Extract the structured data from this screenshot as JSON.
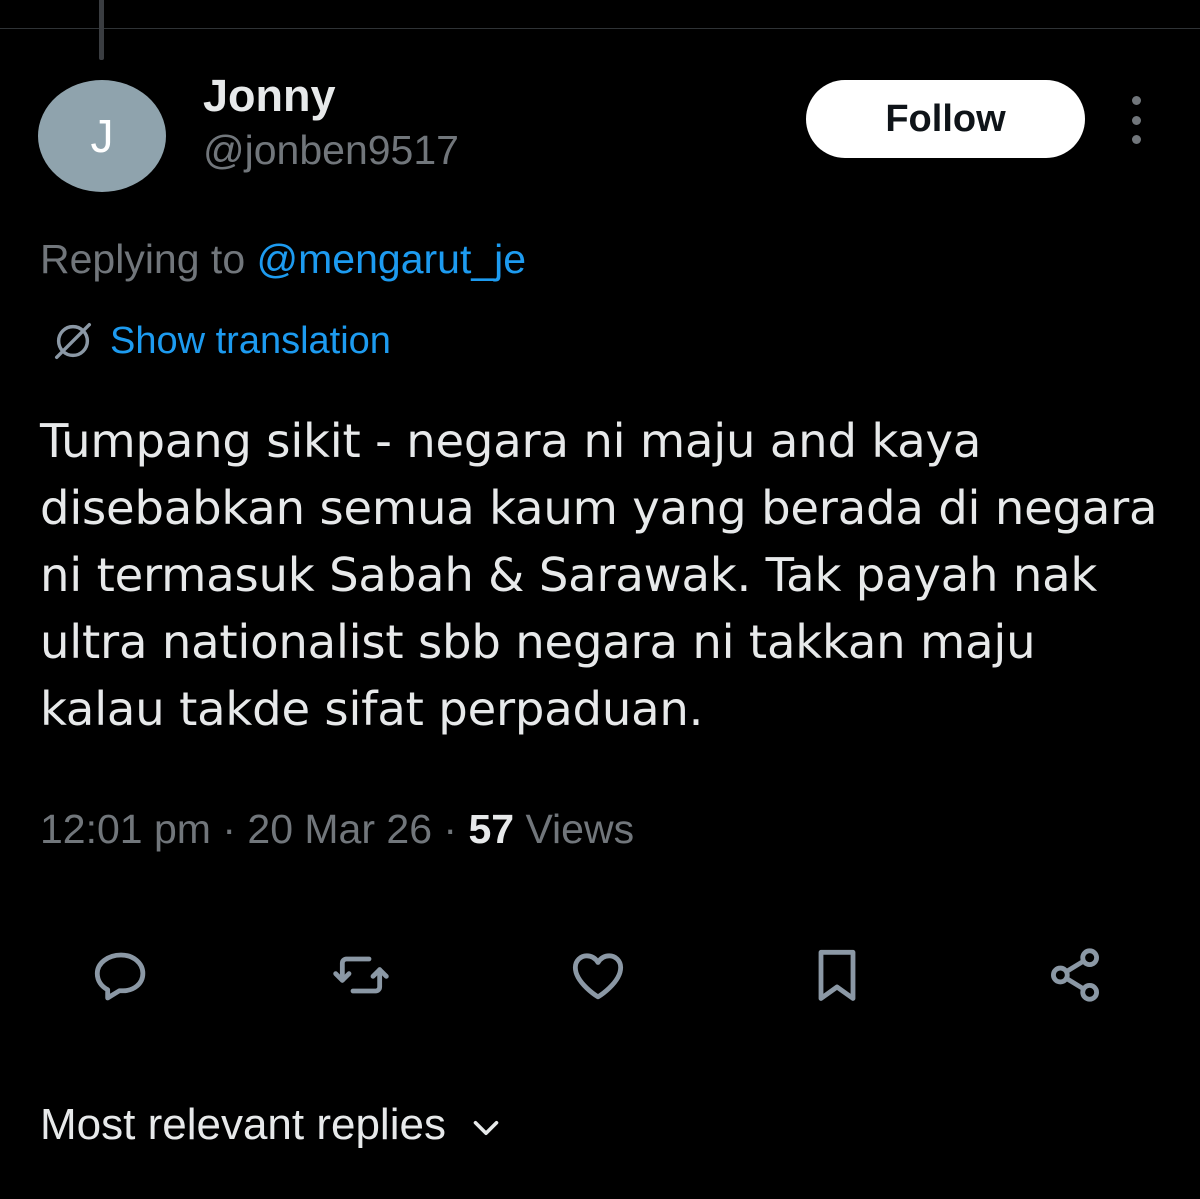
{
  "tweet": {
    "author": {
      "avatar_initial": "J",
      "display_name": "Jonny",
      "handle": "@jonben9517"
    },
    "follow_label": "Follow",
    "replying_to_prefix": "Replying to ",
    "replying_to_handle": "@mengarut_je",
    "show_translation_label": "Show translation",
    "text": "Tumpang sikit - negara ni maju and kaya disebabkan semua kaum yang berada di negara ni termasuk Sabah & Sarawak. Tak payah nak ultra nationalist sbb negara ni takkan maju kalau takde sifat perpaduan.",
    "time": "12:01 pm",
    "separator": " · ",
    "date": "20 Mar 26",
    "views_count": "57",
    "views_label": " Views"
  },
  "actions": {
    "icons": [
      "reply-icon",
      "retweet-icon",
      "like-icon",
      "bookmark-icon",
      "share-icon"
    ]
  },
  "replies_sort": {
    "label": "Most relevant replies"
  },
  "colors": {
    "background": "#000000",
    "text": "#e7e9ea",
    "secondary": "#71767b",
    "accent": "#1d9bf0",
    "avatar": "#8fa3ad"
  }
}
